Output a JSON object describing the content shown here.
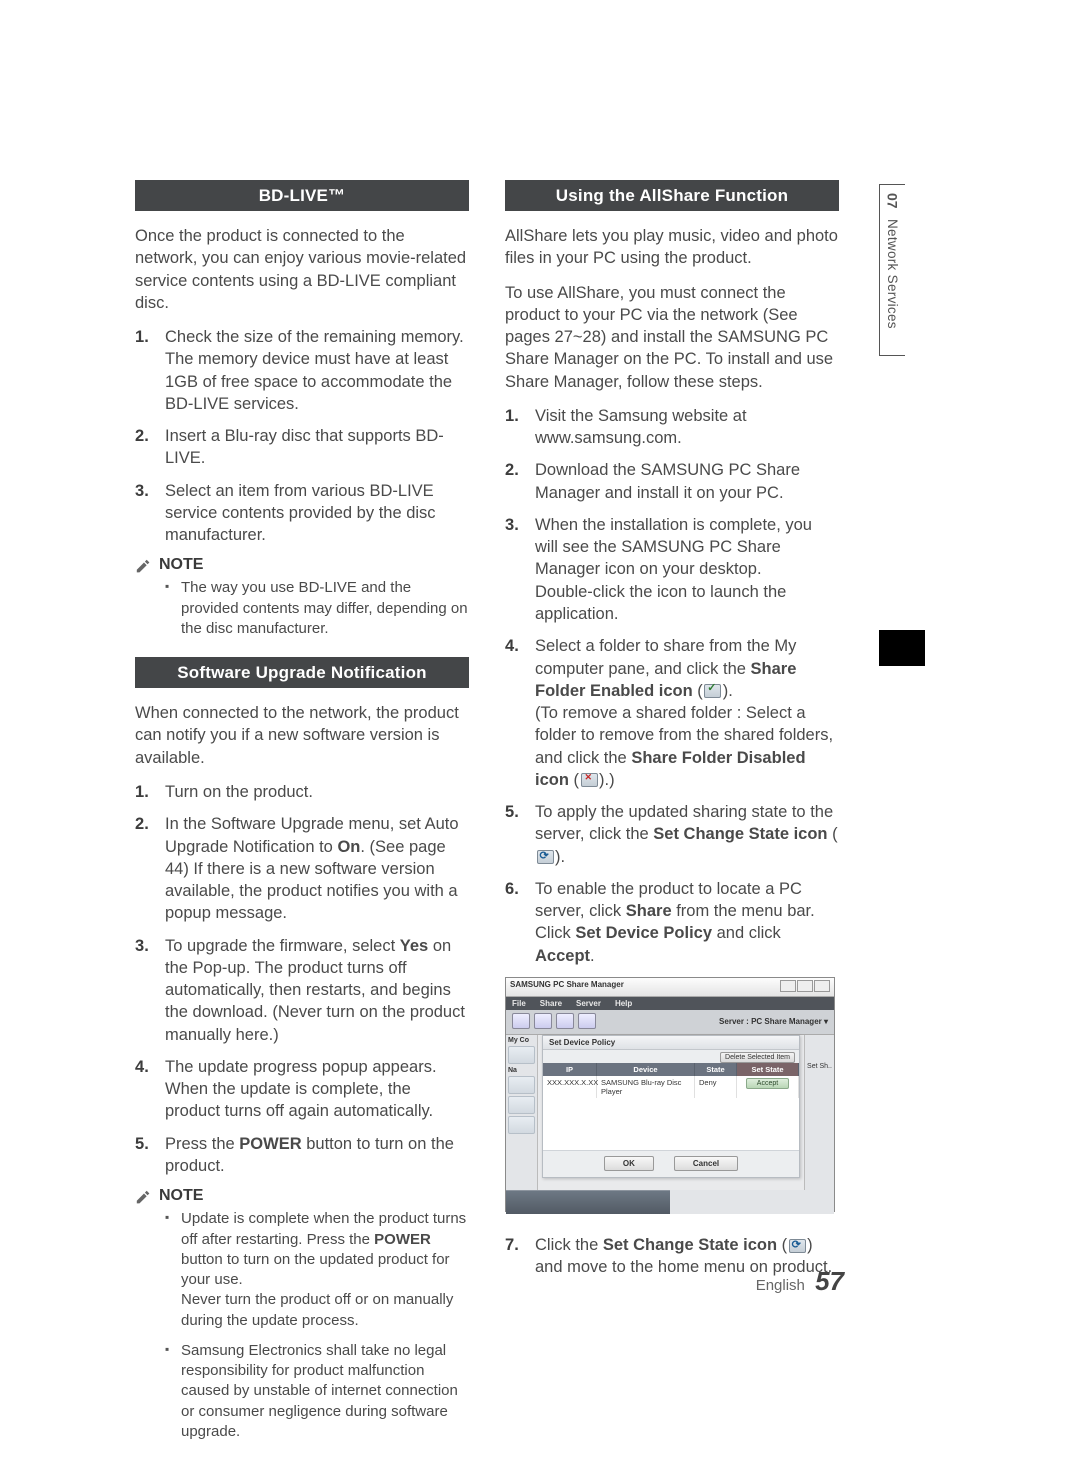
{
  "sideTab": {
    "number": "07",
    "label": "Network Services"
  },
  "footer": {
    "lang": "English",
    "page": "57"
  },
  "bdlive": {
    "heading": "BD-LIVE™",
    "intro": "Once the product is connected to the network, you can enjoy various movie-related service contents using a BD-LIVE compliant disc.",
    "steps": [
      "Check the size of the remaining memory. The memory device must have at least 1GB of free space to accommodate the BD-LIVE services.",
      "Insert a Blu-ray disc that supports BD-LIVE.",
      "Select an item from various BD-LIVE service contents provided by the disc manufacturer."
    ],
    "noteLabel": "NOTE",
    "notes": [
      "The way you use BD-LIVE and the provided contents may differ, depending on the disc manufacturer."
    ]
  },
  "upgrade": {
    "heading": "Software Upgrade Notification",
    "intro": "When connected to the network, the product can notify you if a new software version is available.",
    "steps": [
      {
        "text": "Turn on the product."
      },
      {
        "prefix": "In the Software Upgrade menu, set Auto Upgrade Notification to ",
        "bold1": "On",
        "suffix": ". (See page 44) If there is a new software version available, the product notifies you with a popup message."
      },
      {
        "prefix": "To upgrade the firmware, select ",
        "bold1": "Yes",
        "suffix": " on the Pop-up. The product turns off automatically, then restarts, and begins the download. (Never turn on the product manually here.)"
      },
      {
        "text": "The update progress popup appears. When the update is complete, the product turns off again automatically."
      },
      {
        "prefix": "Press the ",
        "bold1": "POWER",
        "suffix": " button to turn on the product."
      }
    ],
    "noteLabel": "NOTE",
    "notes": [
      {
        "p1": "Update is complete when the product turns off after restarting. Press the ",
        "b1": "POWER",
        "p2": " button to turn on the updated product for your use.",
        "p3": "Never turn the product off or on manually during the update process."
      },
      {
        "text": "Samsung Electronics shall take no legal responsibility for product malfunction caused by unstable of internet connection or consumer negligence during software upgrade."
      }
    ]
  },
  "allshare": {
    "heading": "Using the AllShare Function",
    "para1": "AllShare lets you play music, video and photo files in your PC using the product.",
    "para2": "To use AllShare, you must connect the product to your PC via the network (See pages 27~28) and install the SAMSUNG PC Share Manager on the PC. To install and use Share Manager, follow these steps.",
    "steps": [
      {
        "text": "Visit the Samsung website at www.samsung.com."
      },
      {
        "text": "Download the SAMSUNG PC Share Manager and install it on your PC."
      },
      {
        "p1": "When the installation is complete, you will see the SAMSUNG PC Share Manager icon on your desktop.",
        "p2": "Double-click the icon to launch the application."
      },
      {
        "p1a": "Select a folder to share from the My computer pane, and click the ",
        "b1": "Share Folder Enabled icon",
        "p1b": " (",
        "p1c": ").",
        "p2a": "(To remove a shared folder : Select a folder to remove from the shared folders, and click the ",
        "b2": "Share Folder Disabled icon",
        "p2b": " (",
        "p2c": ").)"
      },
      {
        "p1a": "To apply the updated sharing state to the server, click the ",
        "b1": "Set Change State icon",
        "p1b": " (",
        "p1c": ")."
      },
      {
        "p1a": "To enable the product to locate a PC server, click ",
        "b1": "Share",
        "p1b": " from the menu bar.",
        "p2a": "Click ",
        "b2": "Set Device Policy",
        "p2b": " and click ",
        "b3": "Accept",
        "p2c": "."
      }
    ],
    "step7": {
      "p1a": "Click the ",
      "b1": "Set Change State icon",
      "p1b": " (",
      "p1c": ") and move to the home menu on product."
    }
  },
  "screenshot": {
    "title": "SAMSUNG PC Share Manager",
    "menu": [
      "File",
      "Share",
      "Server",
      "Help"
    ],
    "serverLabel": "Server : PC Share Manager  ▾",
    "myComputer": "My Co",
    "dialogTitle": "Set Device Policy",
    "deleteBtn": "Delete Selected Item",
    "headers": {
      "ip": "IP",
      "device": "Device",
      "state": "State",
      "setState": "Set State"
    },
    "row": {
      "ip": "XXX.XXX.X.XX",
      "device": "SAMSUNG Blu-ray Disc Player",
      "state": "Deny",
      "accept": "Accept"
    },
    "ok": "OK",
    "cancel": "Cancel",
    "rightLabel": "Set Sh.."
  }
}
